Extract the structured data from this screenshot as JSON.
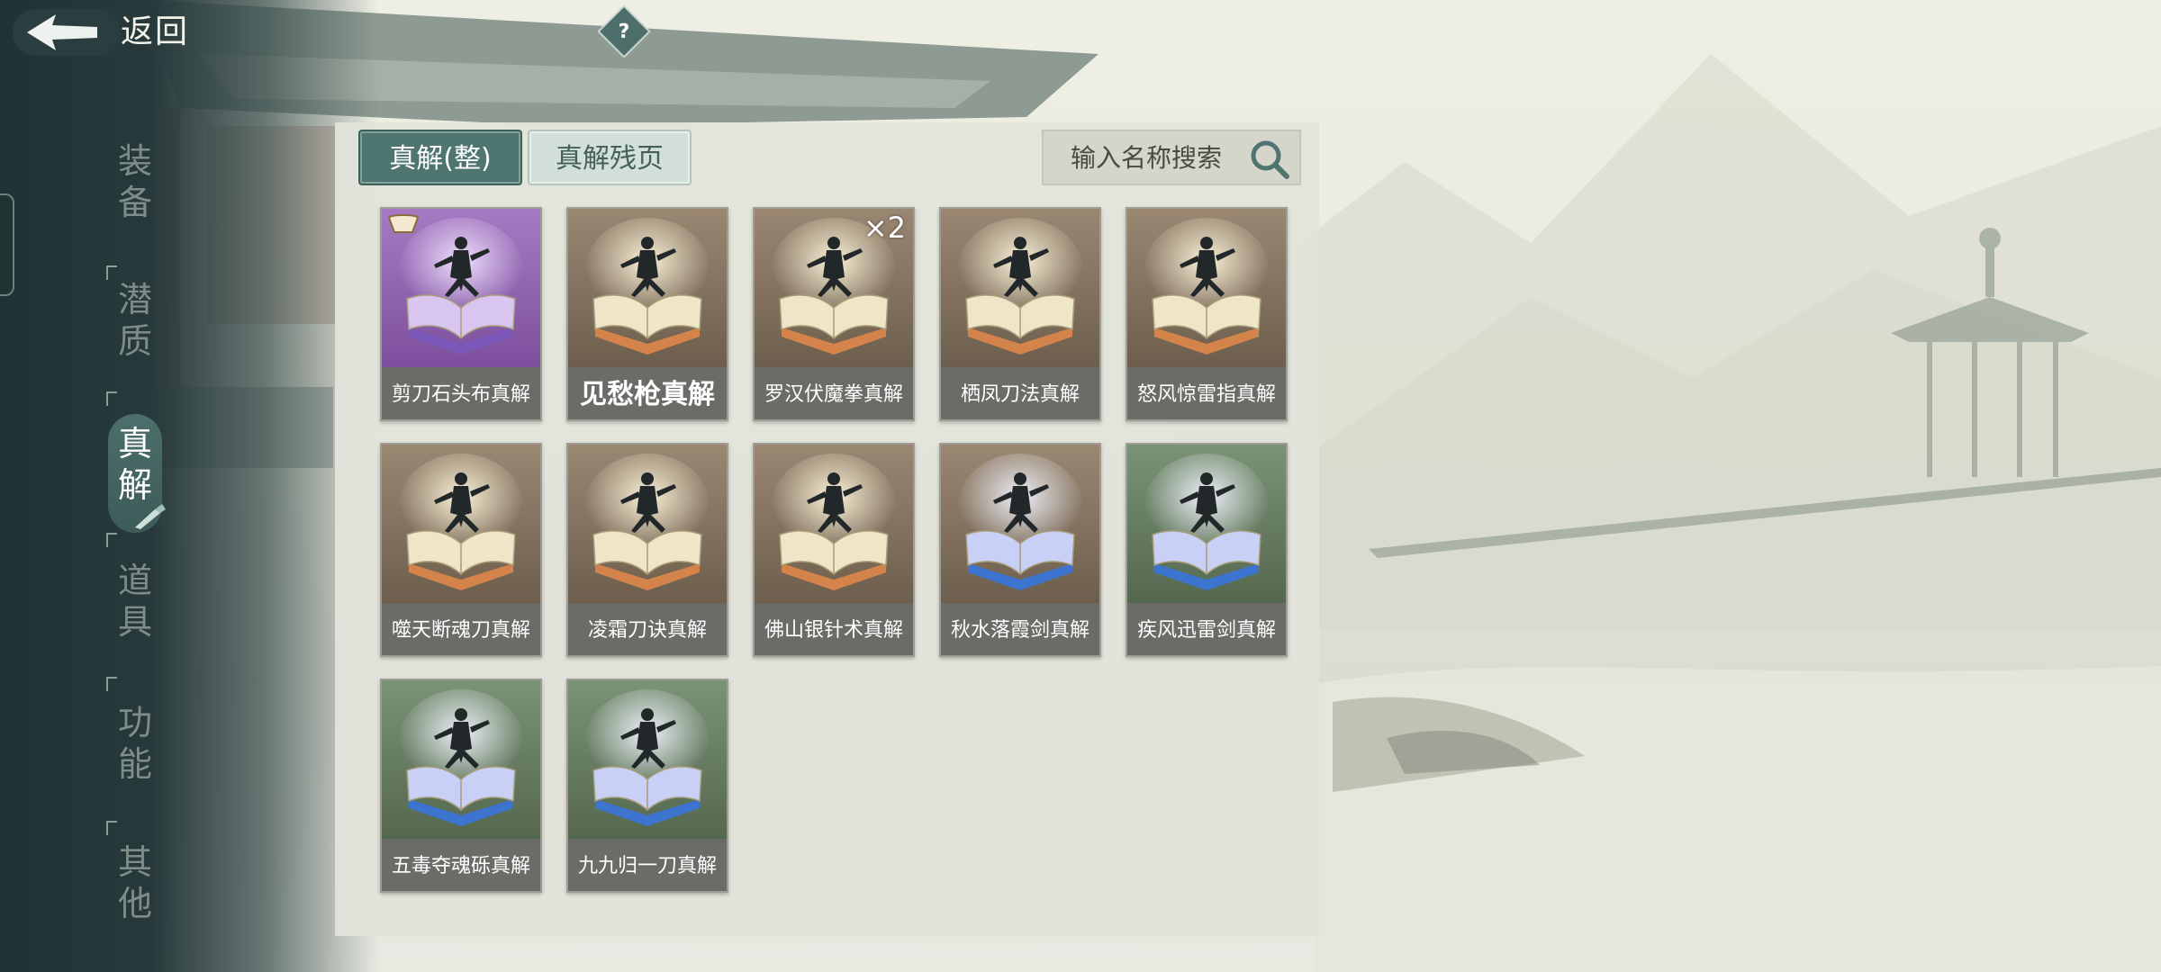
{
  "topbar": {
    "back_label": "返回",
    "help_label": "?"
  },
  "nav": {
    "items": [
      {
        "label": "装备",
        "active": false
      },
      {
        "label": "潜质",
        "active": false
      },
      {
        "label": "真解",
        "active": true
      },
      {
        "label": "道具",
        "active": false
      },
      {
        "label": "功能",
        "active": false
      },
      {
        "label": "其他",
        "active": false
      }
    ]
  },
  "tabs": {
    "full": "真解(整)",
    "fragment": "真解残页"
  },
  "search": {
    "placeholder": "输入名称搜索"
  },
  "colors": {
    "purple_rarity": "#8d5fb0",
    "gold_rarity": "#7c6a55",
    "blue_rarity": "#5e7660",
    "active_tab": "#4f7570"
  },
  "cards": [
    {
      "name": "剪刀石头布真解",
      "rarity": "purple",
      "count": ""
    },
    {
      "name": "见愁枪真解",
      "rarity": "gold",
      "count": ""
    },
    {
      "name": "罗汉伏魔拳真解",
      "rarity": "gold",
      "count": "×2"
    },
    {
      "name": "栖凤刀法真解",
      "rarity": "gold",
      "count": ""
    },
    {
      "name": "怒风惊雷指真解",
      "rarity": "gold",
      "count": ""
    },
    {
      "name": "噬天断魂刀真解",
      "rarity": "gold",
      "count": ""
    },
    {
      "name": "凌霜刀诀真解",
      "rarity": "gold",
      "count": ""
    },
    {
      "name": "佛山银针术真解",
      "rarity": "gold",
      "count": ""
    },
    {
      "name": "秋水落霞剑真解",
      "rarity": "gold-blue",
      "count": ""
    },
    {
      "name": "疾风迅雷剑真解",
      "rarity": "blue",
      "count": ""
    },
    {
      "name": "五毒夺魂砾真解",
      "rarity": "blue",
      "count": ""
    },
    {
      "name": "九九归一刀真解",
      "rarity": "blue",
      "count": ""
    }
  ]
}
